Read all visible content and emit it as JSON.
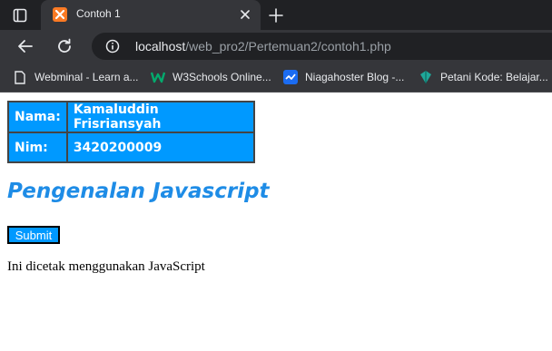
{
  "browser": {
    "tab": {
      "title": "Contoh 1"
    },
    "address_bar": {
      "host": "localhost",
      "path": "/web_pro2/Pertemuan2/contoh1.php"
    },
    "bookmarks": [
      {
        "label": "Webminal - Learn a...",
        "icon": "page-icon"
      },
      {
        "label": "W3Schools Online...",
        "icon": "w3schools-icon"
      },
      {
        "label": "Niagahoster Blog -...",
        "icon": "niagahoster-icon"
      },
      {
        "label": "Petani Kode: Belajar...",
        "icon": "petanikode-icon"
      }
    ],
    "colors": {
      "tabbar": "#202124",
      "toolbar": "#35363a",
      "xampp_orange": "#fb7a24"
    }
  },
  "page": {
    "table": [
      {
        "label": "Nama:",
        "value": "Kamaluddin Frisriansyah"
      },
      {
        "label": "Nim:",
        "value": "3420200009"
      }
    ],
    "heading": "Pengenalan Javascript",
    "submit_label": "Submit",
    "output_text": "Ini dicetak menggunakan JavaScript",
    "colors": {
      "table_bg": "#0099ff",
      "heading": "#1e8ce6",
      "button_bg": "#0099ff"
    }
  }
}
